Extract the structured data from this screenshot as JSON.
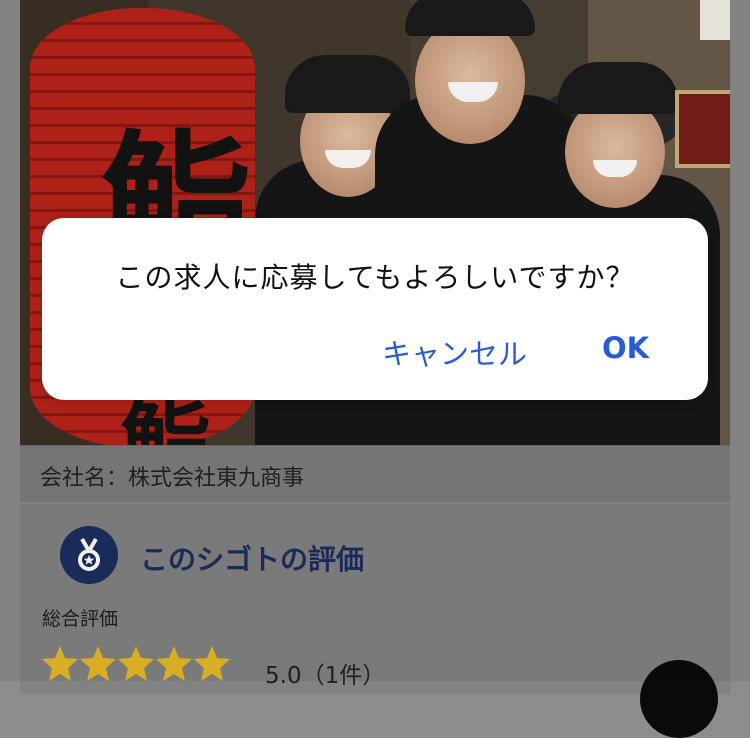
{
  "job": {
    "company_label": "会社名：株式会社東九商事"
  },
  "rating": {
    "title": "このシゴトの評価",
    "overall_label": "総合評価",
    "score_text": "5.0（1件）",
    "stars_filled": 5,
    "stars_total": 5,
    "star_color": "#e7b928",
    "badge_color": "#1c2e60"
  },
  "lantern": {
    "chars": [
      "鮨",
      "鮨"
    ]
  },
  "dialog": {
    "message": "この求人に応募してもよろしいですか？",
    "cancel_label": "キャンセル",
    "ok_label": "OK",
    "button_color": "#2a5bd3"
  },
  "icons": {
    "badge": "medal-icon",
    "star": "star-icon",
    "fab": "floating-action-button"
  }
}
